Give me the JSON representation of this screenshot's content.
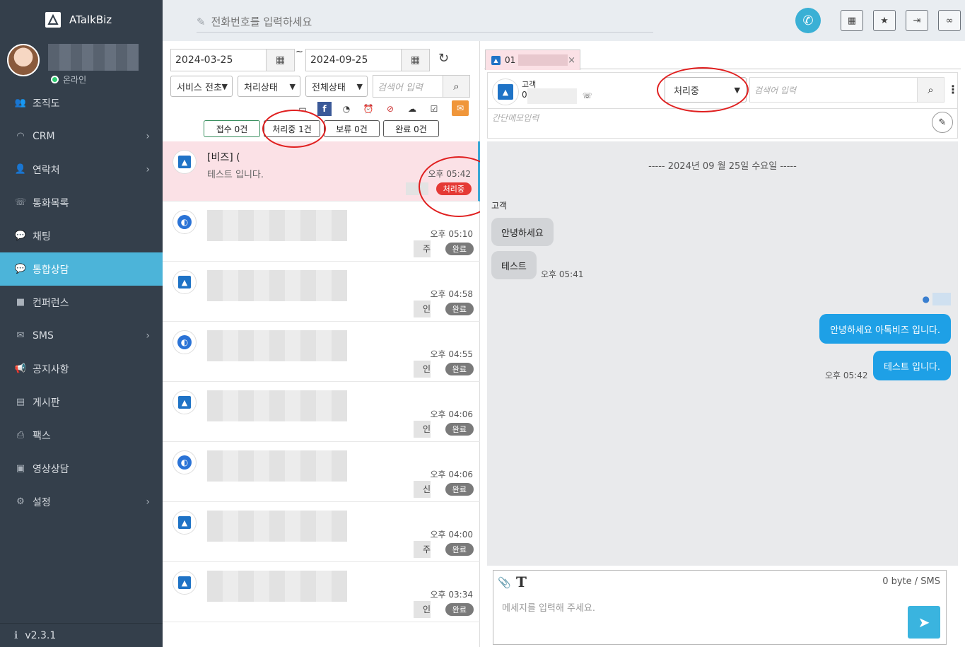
{
  "app": {
    "name": "ATalkBiz",
    "version": "v2.3.1"
  },
  "profile": {
    "status": "온라인"
  },
  "sidebar": {
    "items": [
      {
        "label": "조직도",
        "icon": "users-icon",
        "glyph": "👥",
        "chevron": false
      },
      {
        "label": "CRM",
        "icon": "headset-icon",
        "glyph": "◠",
        "chevron": true
      },
      {
        "label": "연락처",
        "icon": "user-icon",
        "glyph": "👤",
        "chevron": true
      },
      {
        "label": "통화목록",
        "icon": "phone-book-icon",
        "glyph": "☏",
        "chevron": false
      },
      {
        "label": "채팅",
        "icon": "chat-icon",
        "glyph": "💬",
        "chevron": false
      },
      {
        "label": "통합상담",
        "icon": "chat-bubbles-icon",
        "glyph": "💬",
        "chevron": false,
        "active": true
      },
      {
        "label": "컨퍼런스",
        "icon": "video-icon",
        "glyph": "■",
        "chevron": false
      },
      {
        "label": "SMS",
        "icon": "envelope-icon",
        "glyph": "✉",
        "chevron": true
      },
      {
        "label": "공지사항",
        "icon": "megaphone-icon",
        "glyph": "📢",
        "chevron": false
      },
      {
        "label": "게시판",
        "icon": "board-icon",
        "glyph": "▤",
        "chevron": false
      },
      {
        "label": "팩스",
        "icon": "fax-icon",
        "glyph": "⎙",
        "chevron": false
      },
      {
        "label": "영상상담",
        "icon": "video-consult-icon",
        "glyph": "▣",
        "chevron": false
      },
      {
        "label": "설정",
        "icon": "gear-icon",
        "glyph": "⚙",
        "chevron": true
      }
    ]
  },
  "topbar": {
    "phone_placeholder": "전화번호를 입력하세요"
  },
  "filters": {
    "date_from": "2024-03-25",
    "date_to": "2024-09-25",
    "service_select": "서비스 전초",
    "process_select": "처리상태",
    "all_select": "전체상태",
    "search_placeholder": "검색어 입력"
  },
  "status_buttons": [
    {
      "label": "접수 0건"
    },
    {
      "label": "처리중 1건"
    },
    {
      "label": "보류 0건"
    },
    {
      "label": "완료 0건"
    }
  ],
  "list": [
    {
      "title": "[비즈] (",
      "subtitle": "테스트 입니다.",
      "time": "오후 05:42",
      "badge": "처리중",
      "red": true,
      "type": "tri",
      "blur": false
    },
    {
      "time": "오후 05:10",
      "badge": "완료",
      "name": "주",
      "type": "circ",
      "blur": true
    },
    {
      "time": "오후 04:58",
      "badge": "완료",
      "name": "인",
      "type": "tri",
      "blur": true
    },
    {
      "time": "오후 04:55",
      "badge": "완료",
      "name": "인",
      "type": "circ",
      "blur": true
    },
    {
      "time": "오후 04:06",
      "badge": "완료",
      "name": "인",
      "type": "tri",
      "blur": true
    },
    {
      "time": "오후 04:06",
      "badge": "완료",
      "name": "신",
      "type": "circ",
      "blur": true
    },
    {
      "time": "오후 04:00",
      "badge": "완료",
      "name": "주",
      "type": "tri",
      "blur": true
    },
    {
      "time": "오후 03:34",
      "badge": "완료",
      "name": "인",
      "type": "tri",
      "blur": true
    }
  ],
  "chat": {
    "tab_label": "01",
    "customer_label": "고객",
    "customer_num_prefix": "0",
    "status_value": "처리중",
    "search_placeholder": "검색어 입력",
    "memo_placeholder": "간단메모입력",
    "date_separator": "----- 2024년 09 월 25일 수요일 -----",
    "sender_label": "고객",
    "msg_in_1": "안녕하세요",
    "msg_in_2": "테스트",
    "msg_in_time": "오후 05:41",
    "msg_out_1": "안녕하세요 아톡비즈 입니다.",
    "msg_out_2": "테스트 입니다.",
    "msg_out_time": "오후 05:42",
    "composer_placeholder": "메세지를 입력해 주세요.",
    "byte_counter": "0 byte / SMS"
  },
  "colors": {
    "sidebar_bg": "#343f4b",
    "accent": "#4cb4d9",
    "active_row": "#fbe1e6",
    "badge_red": "#e53935",
    "bubble_out": "#1ea0e6"
  }
}
